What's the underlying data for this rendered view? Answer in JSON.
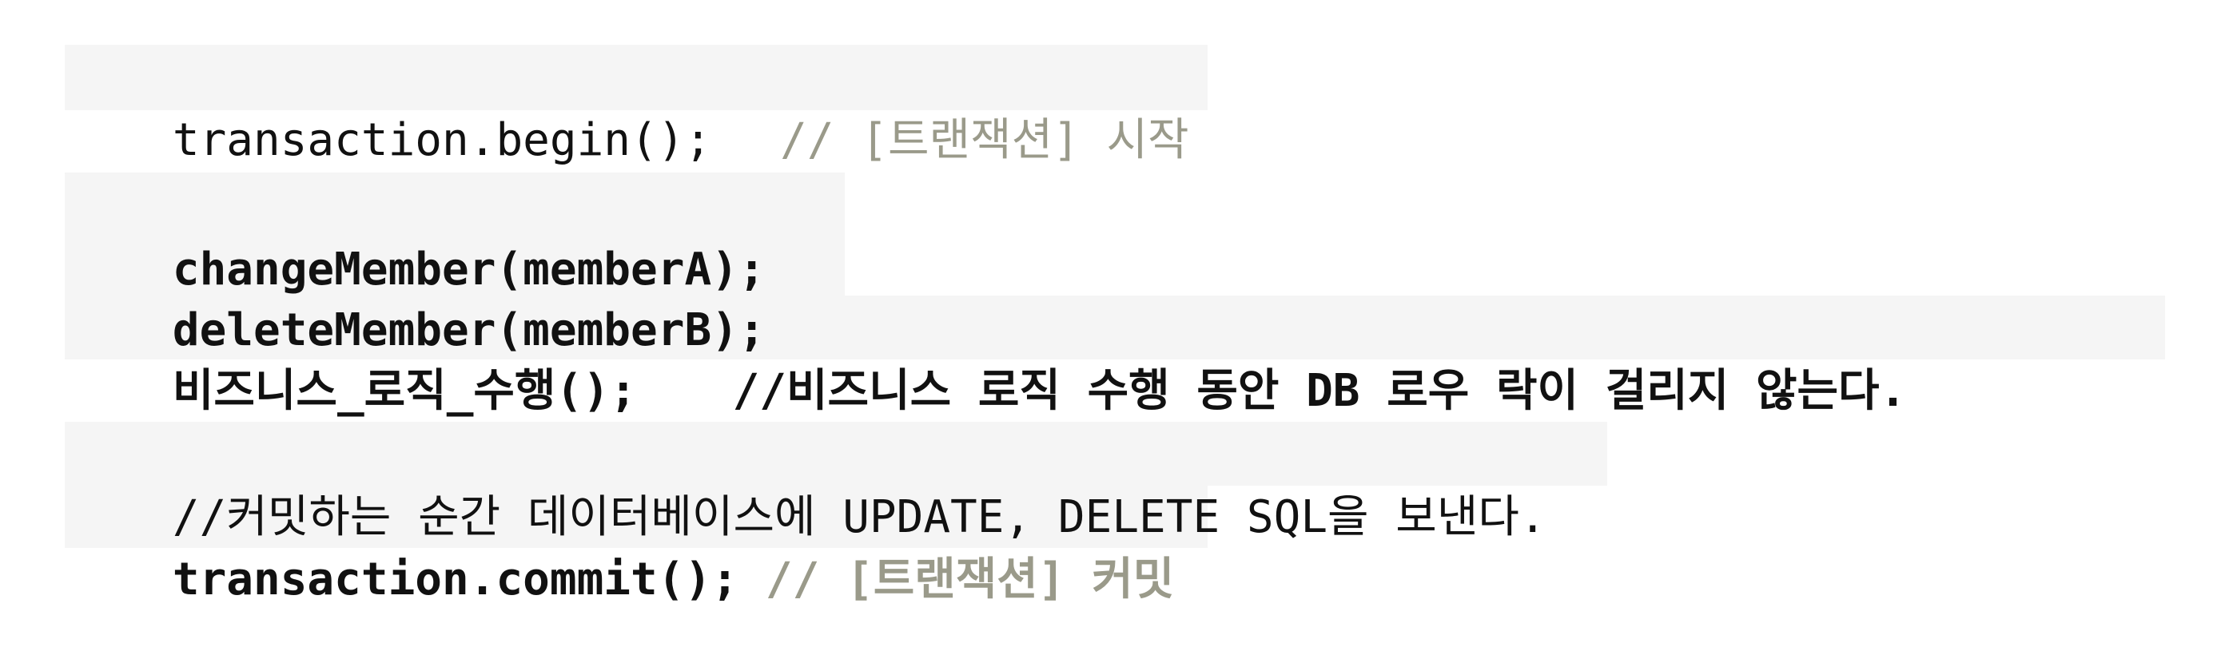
{
  "code": {
    "line1": {
      "code": "transaction.begin();",
      "comment": "// [트랜잭션] 시작"
    },
    "line2": {
      "code": "changeMember(memberA);"
    },
    "line3": {
      "code": "deleteMember(memberB);"
    },
    "line4": {
      "code": "비즈니스_로직_수행();",
      "comment": "//비즈니스 로직 수행 동안 DB 로우 락이 걸리지 않는다."
    },
    "line5": {
      "comment": "//커밋하는 순간 데이터베이스에 UPDATE, DELETE SQL을 보낸다."
    },
    "line6": {
      "code": "transaction.commit();",
      "comment": "// [트랜잭션] 커밋"
    }
  },
  "colors": {
    "background": "#ffffff",
    "highlight": "#f5f5f5",
    "code_text": "#111111",
    "comment_text": "#9a9a8a"
  }
}
